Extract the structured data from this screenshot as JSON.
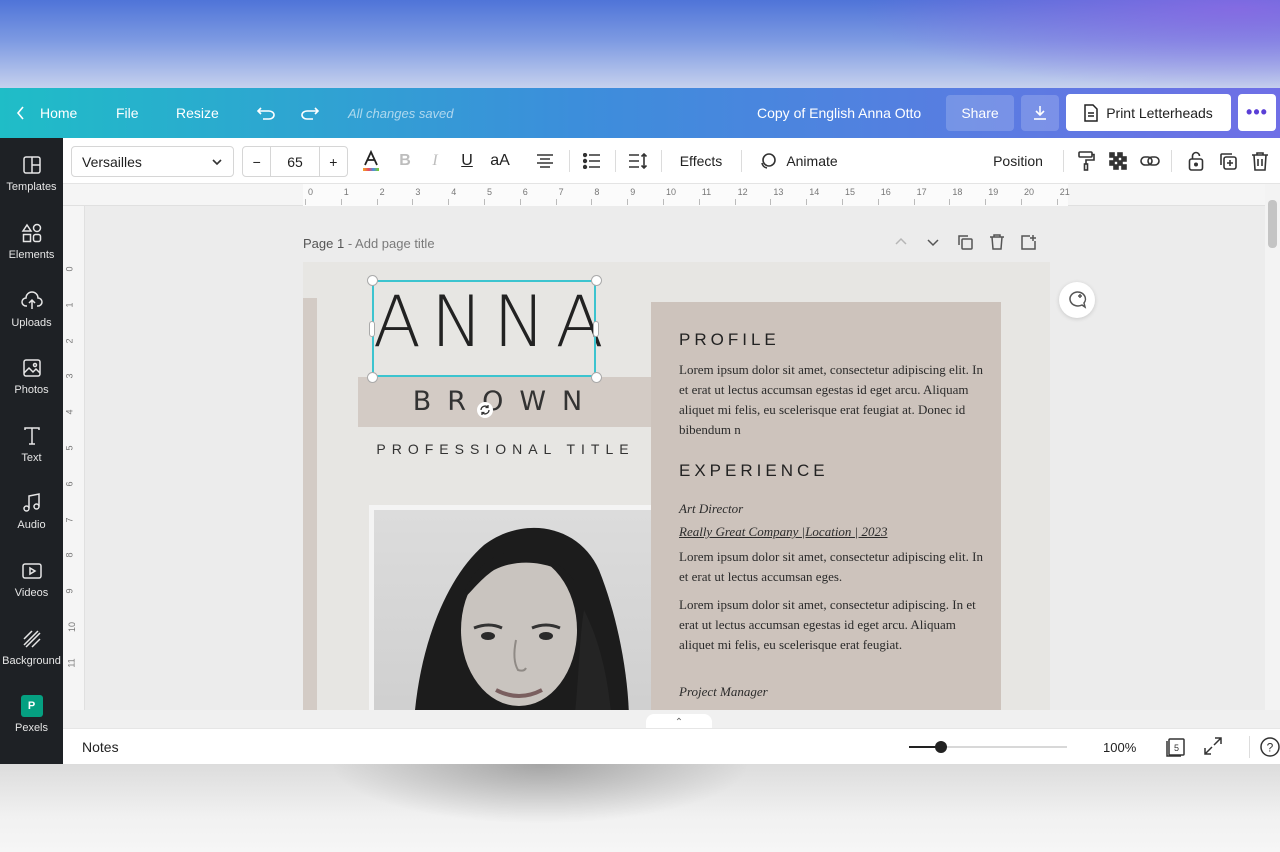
{
  "header": {
    "home_label": "Home",
    "file_label": "File",
    "resize_label": "Resize",
    "saved_status": "All changes saved",
    "doc_title": "Copy of English Anna Otto",
    "share_label": "Share",
    "print_label": "Print Letterheads"
  },
  "sidebar": {
    "items": [
      {
        "label": "Templates",
        "icon": "templates-icon"
      },
      {
        "label": "Elements",
        "icon": "elements-icon"
      },
      {
        "label": "Uploads",
        "icon": "uploads-icon"
      },
      {
        "label": "Photos",
        "icon": "photos-icon"
      },
      {
        "label": "Text",
        "icon": "text-icon"
      },
      {
        "label": "Audio",
        "icon": "audio-icon"
      },
      {
        "label": "Videos",
        "icon": "videos-icon"
      },
      {
        "label": "Background",
        "icon": "background-icon"
      },
      {
        "label": "Pexels",
        "icon": "pexels-icon"
      }
    ]
  },
  "toolbar": {
    "font_family": "Versailles",
    "font_size": "65",
    "minus": "−",
    "plus": "+",
    "effects_label": "Effects",
    "animate_label": "Animate",
    "position_label": "Position"
  },
  "ruler": {
    "h_marks": [
      "0",
      "1",
      "2",
      "3",
      "4",
      "5",
      "6",
      "7",
      "8",
      "9",
      "10",
      "11",
      "12",
      "13",
      "14",
      "15",
      "16",
      "17",
      "18",
      "19",
      "20",
      "21"
    ],
    "v_marks": [
      "0",
      "1",
      "2",
      "3",
      "4",
      "5",
      "6",
      "7",
      "8",
      "9",
      "10",
      "11"
    ]
  },
  "canvas": {
    "page_label": "Page 1",
    "page_title_placeholder": " - Add page title"
  },
  "design": {
    "first_name": "ANNA",
    "last_name": "BROWN",
    "professional_title": "PROFESSIONAL TITLE",
    "profile_heading": "PROFILE",
    "profile_text": "Lorem ipsum dolor sit amet, consectetur adipiscing elit. In et erat ut lectus accumsan egestas id eget arcu. Aliquam aliquet mi felis, eu scelerisque erat feugiat at. Donec id bibendum n",
    "experience_heading": "EXPERIENCE",
    "job1_role": "Art Director",
    "job1_company": "Really Great Company |Location | 2023",
    "job1_text1": "Lorem ipsum dolor sit amet, consectetur adipiscing elit. In et erat ut lectus accumsan eges.",
    "job1_text2": "Lorem ipsum dolor sit amet, consectetur adipiscing. In et erat ut lectus accumsan egestas id eget arcu. Aliquam aliquet mi felis, eu scelerisque erat feugiat.",
    "job2_role": "Project Manager",
    "colors": {
      "panel": "#cdc3bc",
      "band": "#d3cbc5",
      "selection": "#3cc4cf"
    }
  },
  "footer": {
    "notes_label": "Notes",
    "zoom_value": "100%",
    "zoom_level": 0.2,
    "page_count": "5",
    "help": "?"
  }
}
